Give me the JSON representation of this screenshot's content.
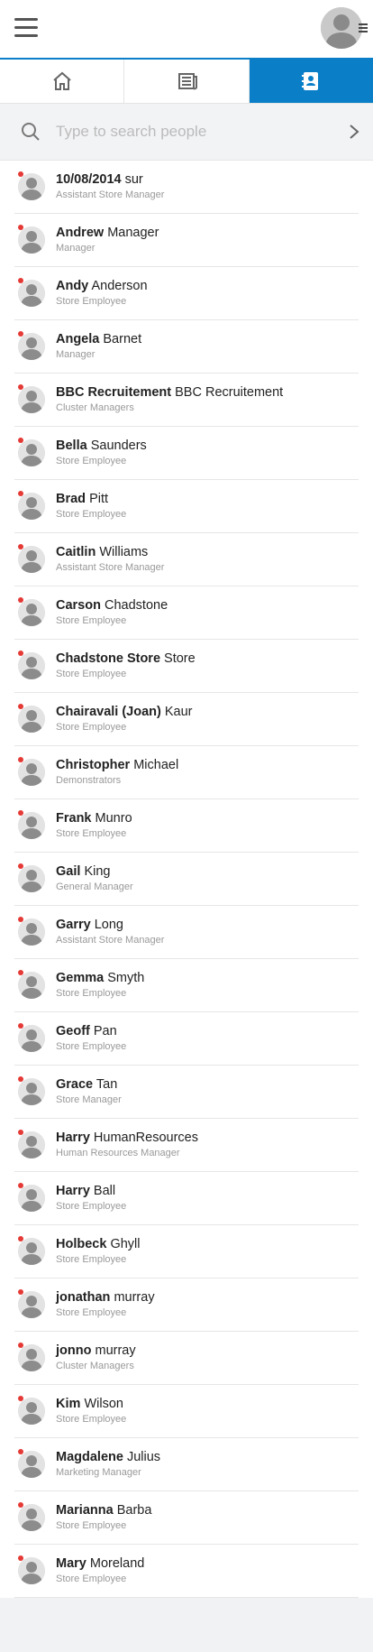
{
  "header": {
    "menu_icon": "hamburger-icon",
    "avatar_icon": "user-avatar-icon"
  },
  "tabs": [
    {
      "icon": "home-icon",
      "active": false
    },
    {
      "icon": "news-icon",
      "active": false
    },
    {
      "icon": "contacts-icon",
      "active": true
    }
  ],
  "search": {
    "placeholder": "Type to search people"
  },
  "people": [
    {
      "first": "10/08/2014",
      "last": "sur",
      "role": "Assistant Store Manager"
    },
    {
      "first": "Andrew",
      "last": "Manager",
      "role": "Manager"
    },
    {
      "first": "Andy",
      "last": "Anderson",
      "role": "Store Employee"
    },
    {
      "first": "Angela",
      "last": "Barnet",
      "role": "Manager"
    },
    {
      "first": "BBC Recruitement",
      "last": "BBC Recruitement",
      "role": "Cluster Managers"
    },
    {
      "first": "Bella",
      "last": "Saunders",
      "role": "Store Employee"
    },
    {
      "first": "Brad",
      "last": "Pitt",
      "role": "Store Employee"
    },
    {
      "first": "Caitlin",
      "last": "Williams",
      "role": "Assistant Store Manager"
    },
    {
      "first": "Carson",
      "last": "Chadstone",
      "role": "Store Employee"
    },
    {
      "first": "Chadstone Store",
      "last": "Store",
      "role": "Store Employee"
    },
    {
      "first": "Chairavali (Joan)",
      "last": "Kaur",
      "role": "Store Employee"
    },
    {
      "first": "Christopher",
      "last": "Michael",
      "role": "Demonstrators"
    },
    {
      "first": "Frank",
      "last": "Munro",
      "role": "Store Employee"
    },
    {
      "first": "Gail",
      "last": "King",
      "role": "General Manager"
    },
    {
      "first": "Garry",
      "last": "Long",
      "role": "Assistant Store Manager"
    },
    {
      "first": "Gemma",
      "last": "Smyth",
      "role": "Store Employee"
    },
    {
      "first": "Geoff",
      "last": "Pan",
      "role": "Store Employee"
    },
    {
      "first": "Grace",
      "last": "Tan",
      "role": "Store Manager"
    },
    {
      "first": "Harry",
      "last": "HumanResources",
      "role": "Human Resources Manager"
    },
    {
      "first": "Harry",
      "last": "Ball",
      "role": "Store Employee"
    },
    {
      "first": "Holbeck",
      "last": "Ghyll",
      "role": "Store Employee"
    },
    {
      "first": "jonathan",
      "last": "murray",
      "role": "Store Employee"
    },
    {
      "first": "jonno",
      "last": "murray",
      "role": "Cluster Managers"
    },
    {
      "first": "Kim",
      "last": "Wilson",
      "role": "Store Employee"
    },
    {
      "first": "Magdalene",
      "last": "Julius",
      "role": "Marketing Manager"
    },
    {
      "first": "Marianna",
      "last": "Barba",
      "role": "Store Employee"
    },
    {
      "first": "Mary",
      "last": "Moreland",
      "role": "Store Employee"
    }
  ],
  "colors": {
    "accent": "#0a7fc8",
    "status_dot": "#e53935"
  }
}
